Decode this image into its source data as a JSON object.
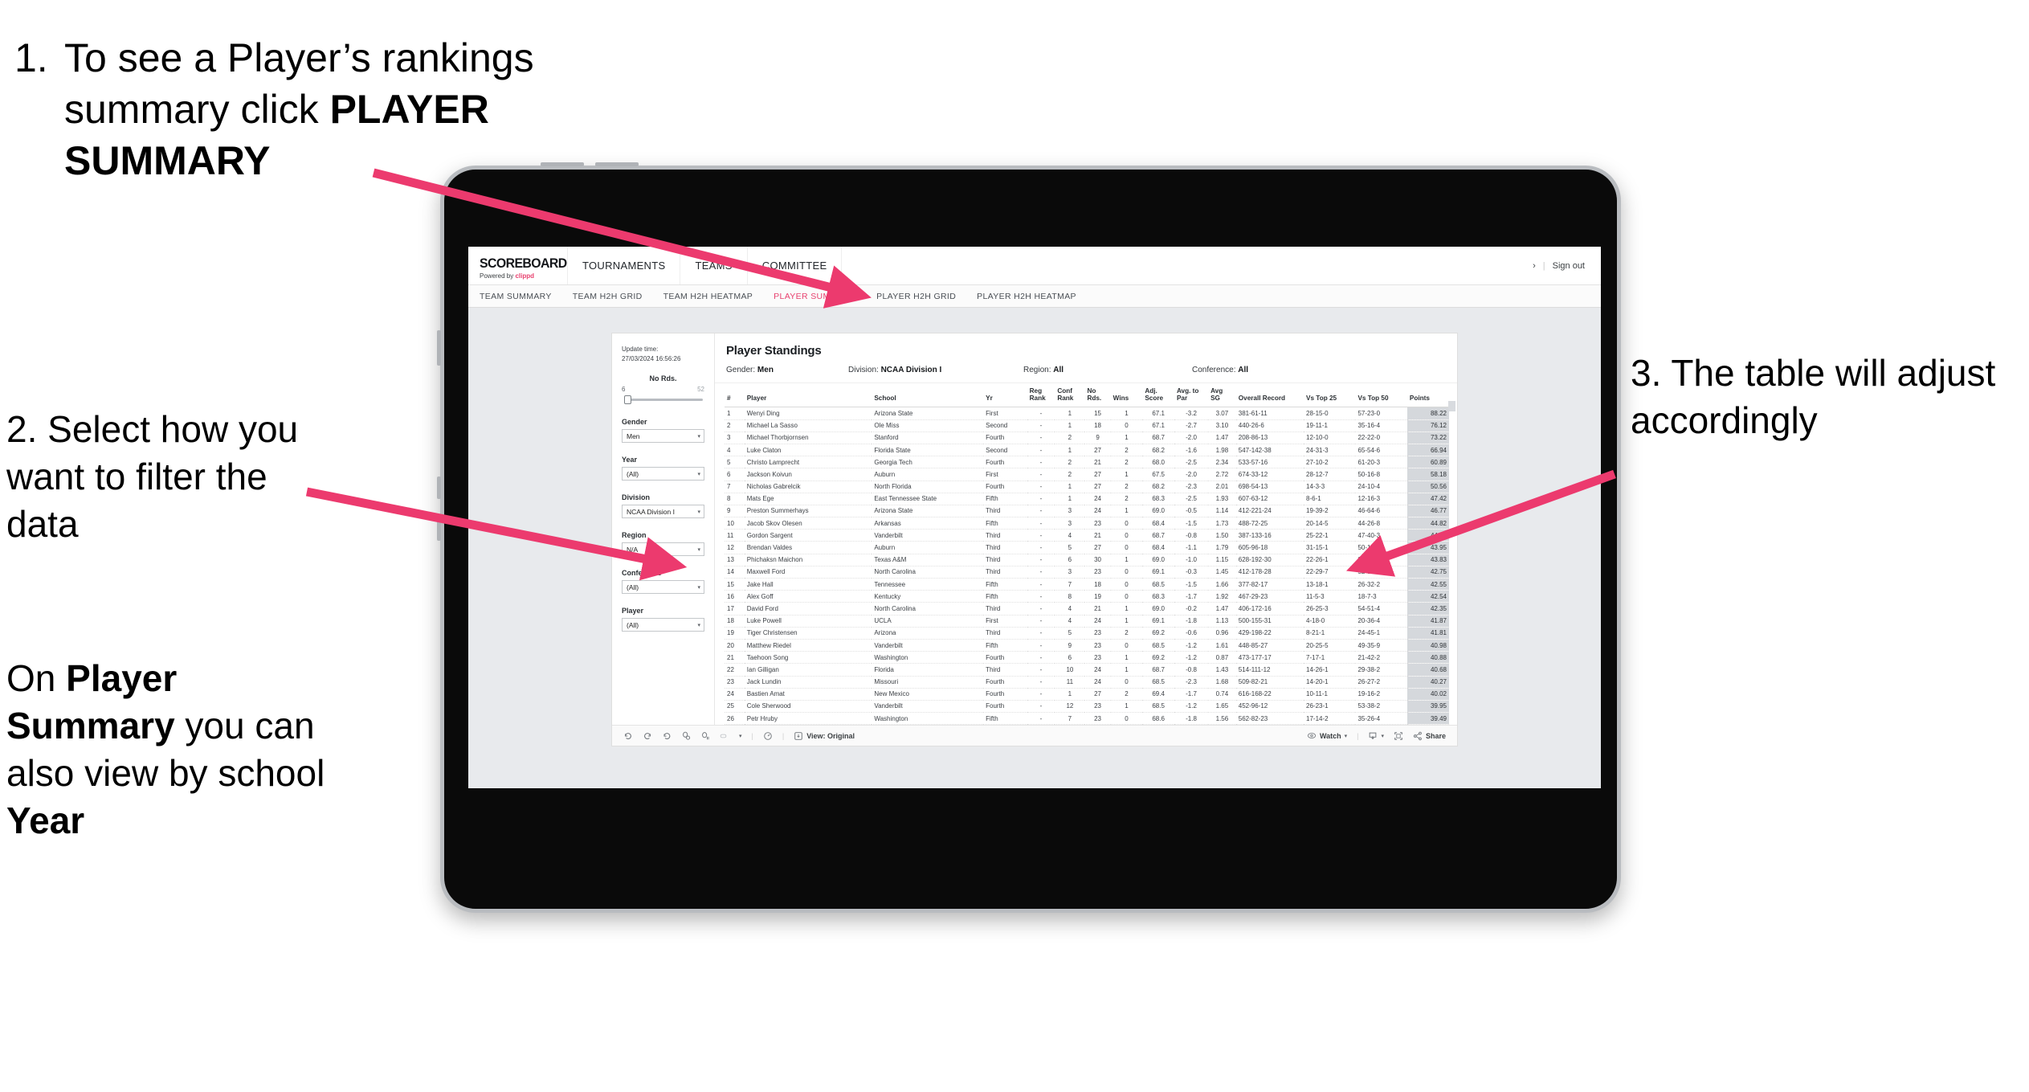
{
  "annotations": {
    "step1": {
      "number": "1.",
      "line1": "To see a Player’s rankings",
      "line2_pre": "summary click ",
      "line2_bold": "PLAYER",
      "line3_bold": "SUMMARY"
    },
    "step2": {
      "text": "2. Select how you want to filter the data"
    },
    "step2b": {
      "pre": "On ",
      "bold1": "Player Summary",
      "mid": " you can also view by school ",
      "bold2": "Year"
    },
    "step3": {
      "text": "3. The table will adjust accordingly"
    }
  },
  "app": {
    "brand_title": "SCOREBOARD",
    "brand_sub_pre": "Powered by ",
    "brand_sub_pink": "clippd",
    "nav": [
      "TOURNAMENTS",
      "TEAMS",
      "COMMITTEE"
    ],
    "chevron": "›",
    "divider": "|",
    "sign_out": "Sign out",
    "tabs": [
      {
        "label": "TEAM SUMMARY",
        "active": false
      },
      {
        "label": "TEAM H2H GRID",
        "active": false
      },
      {
        "label": "TEAM H2H HEATMAP",
        "active": false
      },
      {
        "label": "PLAYER SUMMARY",
        "active": true
      },
      {
        "label": "PLAYER H2H GRID",
        "active": false
      },
      {
        "label": "PLAYER H2H HEATMAP",
        "active": false
      }
    ],
    "accent_pink": "#e8416f"
  },
  "sidebar": {
    "update_label": "Update time:",
    "update_value": "27/03/2024 16:56:26",
    "slider": {
      "title": "No Rds.",
      "min": "6",
      "max": "52"
    },
    "filters": [
      {
        "label": "Gender",
        "value": "Men"
      },
      {
        "label": "Year",
        "value": "(All)"
      },
      {
        "label": "Division",
        "value": "NCAA Division I"
      },
      {
        "label": "Region",
        "value": "N/A"
      },
      {
        "label": "Conference",
        "value": "(All)"
      },
      {
        "label": "Player",
        "value": "(All)"
      }
    ]
  },
  "viz": {
    "title": "Player Standings",
    "meta": [
      {
        "label": "Gender:",
        "value": "Men"
      },
      {
        "label": "Division:",
        "value": "NCAA Division I"
      },
      {
        "label": "Region:",
        "value": "All"
      },
      {
        "label": "Conference:",
        "value": "All"
      }
    ]
  },
  "table": {
    "columns": [
      "#",
      "Player",
      "School",
      "Yr",
      "Reg Rank",
      "Conf Rank",
      "No Rds.",
      "Wins",
      "Adj. Score",
      "Avg. to Par",
      "Avg SG",
      "Overall Record",
      "Vs Top 25",
      "Vs Top 50",
      "Points"
    ],
    "rows": [
      [
        "1",
        "Wenyi Ding",
        "Arizona State",
        "First",
        "-",
        "1",
        "15",
        "1",
        "67.1",
        "-3.2",
        "3.07",
        "381-61-11",
        "28-15-0",
        "57-23-0",
        "88.22"
      ],
      [
        "2",
        "Michael La Sasso",
        "Ole Miss",
        "Second",
        "-",
        "1",
        "18",
        "0",
        "67.1",
        "-2.7",
        "3.10",
        "440-26-6",
        "19-11-1",
        "35-16-4",
        "76.12"
      ],
      [
        "3",
        "Michael Thorbjornsen",
        "Stanford",
        "Fourth",
        "-",
        "2",
        "9",
        "1",
        "68.7",
        "-2.0",
        "1.47",
        "208-86-13",
        "12-10-0",
        "22-22-0",
        "73.22"
      ],
      [
        "4",
        "Luke Claton",
        "Florida State",
        "Second",
        "-",
        "1",
        "27",
        "2",
        "68.2",
        "-1.6",
        "1.98",
        "547-142-38",
        "24-31-3",
        "65-54-6",
        "66.94"
      ],
      [
        "5",
        "Christo Lamprecht",
        "Georgia Tech",
        "Fourth",
        "-",
        "2",
        "21",
        "2",
        "68.0",
        "-2.5",
        "2.34",
        "533-57-16",
        "27-10-2",
        "61-20-3",
        "60.89"
      ],
      [
        "6",
        "Jackson Koivun",
        "Auburn",
        "First",
        "-",
        "2",
        "27",
        "1",
        "67.5",
        "-2.0",
        "2.72",
        "674-33-12",
        "28-12-7",
        "50-16-8",
        "58.18"
      ],
      [
        "7",
        "Nicholas Gabrelcik",
        "North Florida",
        "Fourth",
        "-",
        "1",
        "27",
        "2",
        "68.2",
        "-2.3",
        "2.01",
        "698-54-13",
        "14-3-3",
        "24-10-4",
        "50.56"
      ],
      [
        "8",
        "Mats Ege",
        "East Tennessee State",
        "Fifth",
        "-",
        "1",
        "24",
        "2",
        "68.3",
        "-2.5",
        "1.93",
        "607-63-12",
        "8-6-1",
        "12-16-3",
        "47.42"
      ],
      [
        "9",
        "Preston Summerhays",
        "Arizona State",
        "Third",
        "-",
        "3",
        "24",
        "1",
        "69.0",
        "-0.5",
        "1.14",
        "412-221-24",
        "19-39-2",
        "46-64-6",
        "46.77"
      ],
      [
        "10",
        "Jacob Skov Olesen",
        "Arkansas",
        "Fifth",
        "-",
        "3",
        "23",
        "0",
        "68.4",
        "-1.5",
        "1.73",
        "488-72-25",
        "20-14-5",
        "44-26-8",
        "44.82"
      ],
      [
        "11",
        "Gordon Sargent",
        "Vanderbilt",
        "Third",
        "-",
        "4",
        "21",
        "0",
        "68.7",
        "-0.8",
        "1.50",
        "387-133-16",
        "25-22-1",
        "47-40-3",
        "44.49"
      ],
      [
        "12",
        "Brendan Valdes",
        "Auburn",
        "Third",
        "-",
        "5",
        "27",
        "0",
        "68.4",
        "-1.1",
        "1.79",
        "605-96-18",
        "31-15-1",
        "50-18-5",
        "43.95"
      ],
      [
        "13",
        "Phichaksn Maichon",
        "Texas A&M",
        "Third",
        "-",
        "6",
        "30",
        "1",
        "69.0",
        "-1.0",
        "1.15",
        "628-192-30",
        "22-26-1",
        "38-46-4",
        "43.83"
      ],
      [
        "14",
        "Maxwell Ford",
        "North Carolina",
        "Third",
        "-",
        "3",
        "23",
        "0",
        "69.1",
        "-0.3",
        "1.45",
        "412-178-28",
        "22-29-7",
        "52-51-10",
        "42.75"
      ],
      [
        "15",
        "Jake Hall",
        "Tennessee",
        "Fifth",
        "-",
        "7",
        "18",
        "0",
        "68.5",
        "-1.5",
        "1.66",
        "377-82-17",
        "13-18-1",
        "26-32-2",
        "42.55"
      ],
      [
        "16",
        "Alex Goff",
        "Kentucky",
        "Fifth",
        "-",
        "8",
        "19",
        "0",
        "68.3",
        "-1.7",
        "1.92",
        "467-29-23",
        "11-5-3",
        "18-7-3",
        "42.54"
      ],
      [
        "17",
        "David Ford",
        "North Carolina",
        "Third",
        "-",
        "4",
        "21",
        "1",
        "69.0",
        "-0.2",
        "1.47",
        "406-172-16",
        "26-25-3",
        "54-51-4",
        "42.35"
      ],
      [
        "18",
        "Luke Powell",
        "UCLA",
        "First",
        "-",
        "4",
        "24",
        "1",
        "69.1",
        "-1.8",
        "1.13",
        "500-155-31",
        "4-18-0",
        "20-36-4",
        "41.87"
      ],
      [
        "19",
        "Tiger Christensen",
        "Arizona",
        "Third",
        "-",
        "5",
        "23",
        "2",
        "69.2",
        "-0.6",
        "0.96",
        "429-198-22",
        "8-21-1",
        "24-45-1",
        "41.81"
      ],
      [
        "20",
        "Matthew Riedel",
        "Vanderbilt",
        "Fifth",
        "-",
        "9",
        "23",
        "0",
        "68.5",
        "-1.2",
        "1.61",
        "448-85-27",
        "20-25-5",
        "49-35-9",
        "40.98"
      ],
      [
        "21",
        "Taehoon Song",
        "Washington",
        "Fourth",
        "-",
        "6",
        "23",
        "1",
        "69.2",
        "-1.2",
        "0.87",
        "473-177-17",
        "7-17-1",
        "21-42-2",
        "40.88"
      ],
      [
        "22",
        "Ian Gilligan",
        "Florida",
        "Third",
        "-",
        "10",
        "24",
        "1",
        "68.7",
        "-0.8",
        "1.43",
        "514-111-12",
        "14-26-1",
        "29-38-2",
        "40.68"
      ],
      [
        "23",
        "Jack Lundin",
        "Missouri",
        "Fourth",
        "-",
        "11",
        "24",
        "0",
        "68.5",
        "-2.3",
        "1.68",
        "509-82-21",
        "14-20-1",
        "26-27-2",
        "40.27"
      ],
      [
        "24",
        "Bastien Amat",
        "New Mexico",
        "Fourth",
        "-",
        "1",
        "27",
        "2",
        "69.4",
        "-1.7",
        "0.74",
        "616-168-22",
        "10-11-1",
        "19-16-2",
        "40.02"
      ],
      [
        "25",
        "Cole Sherwood",
        "Vanderbilt",
        "Fourth",
        "-",
        "12",
        "23",
        "1",
        "68.5",
        "-1.2",
        "1.65",
        "452-96-12",
        "26-23-1",
        "53-38-2",
        "39.95"
      ],
      [
        "26",
        "Petr Hruby",
        "Washington",
        "Fifth",
        "-",
        "7",
        "23",
        "0",
        "68.6",
        "-1.8",
        "1.56",
        "562-82-23",
        "17-14-2",
        "35-26-4",
        "39.49"
      ]
    ]
  },
  "bottombar": {
    "view_label": "View: Original",
    "watch_label": "Watch",
    "share_label": "Share",
    "caret": "▾",
    "sep": "|"
  }
}
